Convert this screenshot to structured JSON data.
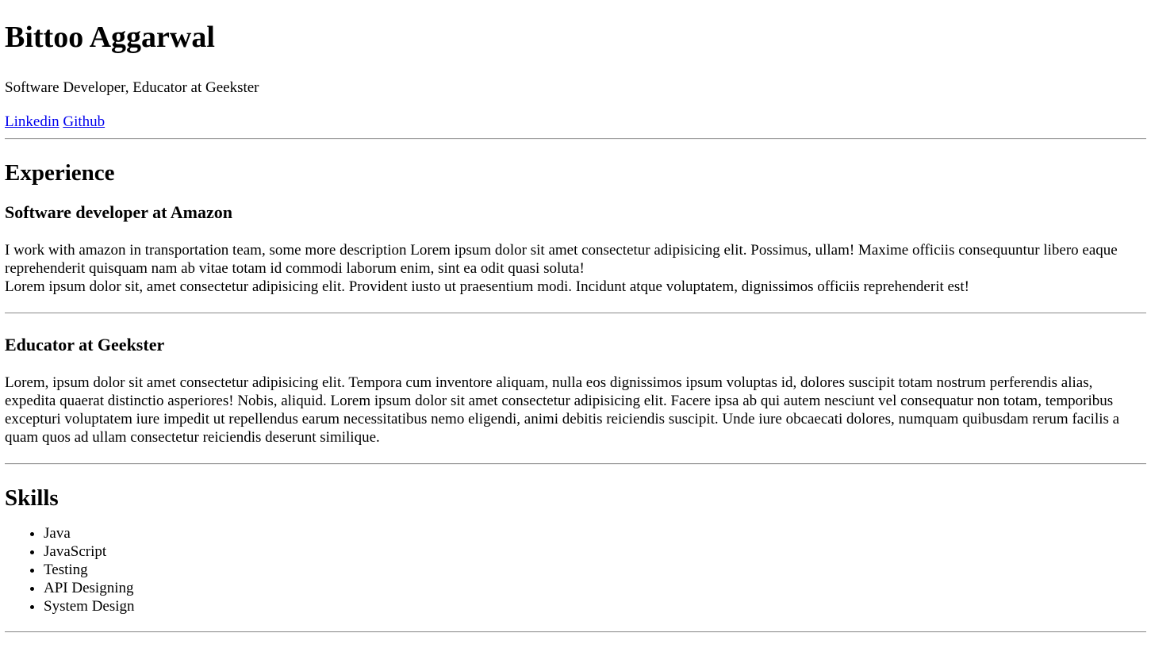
{
  "profile": {
    "name": "Bittoo Aggarwal",
    "subtitle": "Software Developer, Educator at Geekster",
    "links": [
      {
        "label": "Linkedin"
      },
      {
        "label": "Github"
      }
    ]
  },
  "experience": {
    "heading": "Experience",
    "jobs": [
      {
        "title": "Software developer at Amazon",
        "description_line1": "I work with amazon in transportation team, some more description Lorem ipsum dolor sit amet consectetur adipisicing elit. Possimus, ullam! Maxime officiis consequuntur libero eaque reprehenderit quisquam nam ab vitae totam id commodi laborum enim, sint ea odit quasi soluta!",
        "description_line2": "Lorem ipsum dolor sit, amet consectetur adipisicing elit. Provident iusto ut praesentium modi. Incidunt atque voluptatem, dignissimos officiis reprehenderit est!"
      },
      {
        "title": "Educator at Geekster",
        "description": "Lorem, ipsum dolor sit amet consectetur adipisicing elit. Tempora cum inventore aliquam, nulla eos dignissimos ipsum voluptas id, dolores suscipit totam nostrum perferendis alias, expedita quaerat distinctio asperiores! Nobis, aliquid. Lorem ipsum dolor sit amet consectetur adipisicing elit. Facere ipsa ab qui autem nesciunt vel consequatur non totam, temporibus excepturi voluptatem iure impedit ut repellendus earum necessitatibus nemo eligendi, animi debitis reiciendis suscipit. Unde iure obcaecati dolores, numquam quibusdam rerum facilis a quam quos ad ullam consectetur reiciendis deserunt similique."
      }
    ]
  },
  "skills": {
    "heading": "Skills",
    "items": [
      "Java",
      "JavaScript",
      "Testing",
      "API Designing",
      "System Design"
    ]
  },
  "colors": {
    "link": "#0000ee",
    "text": "#000000",
    "divider": "#9a9a9a"
  }
}
